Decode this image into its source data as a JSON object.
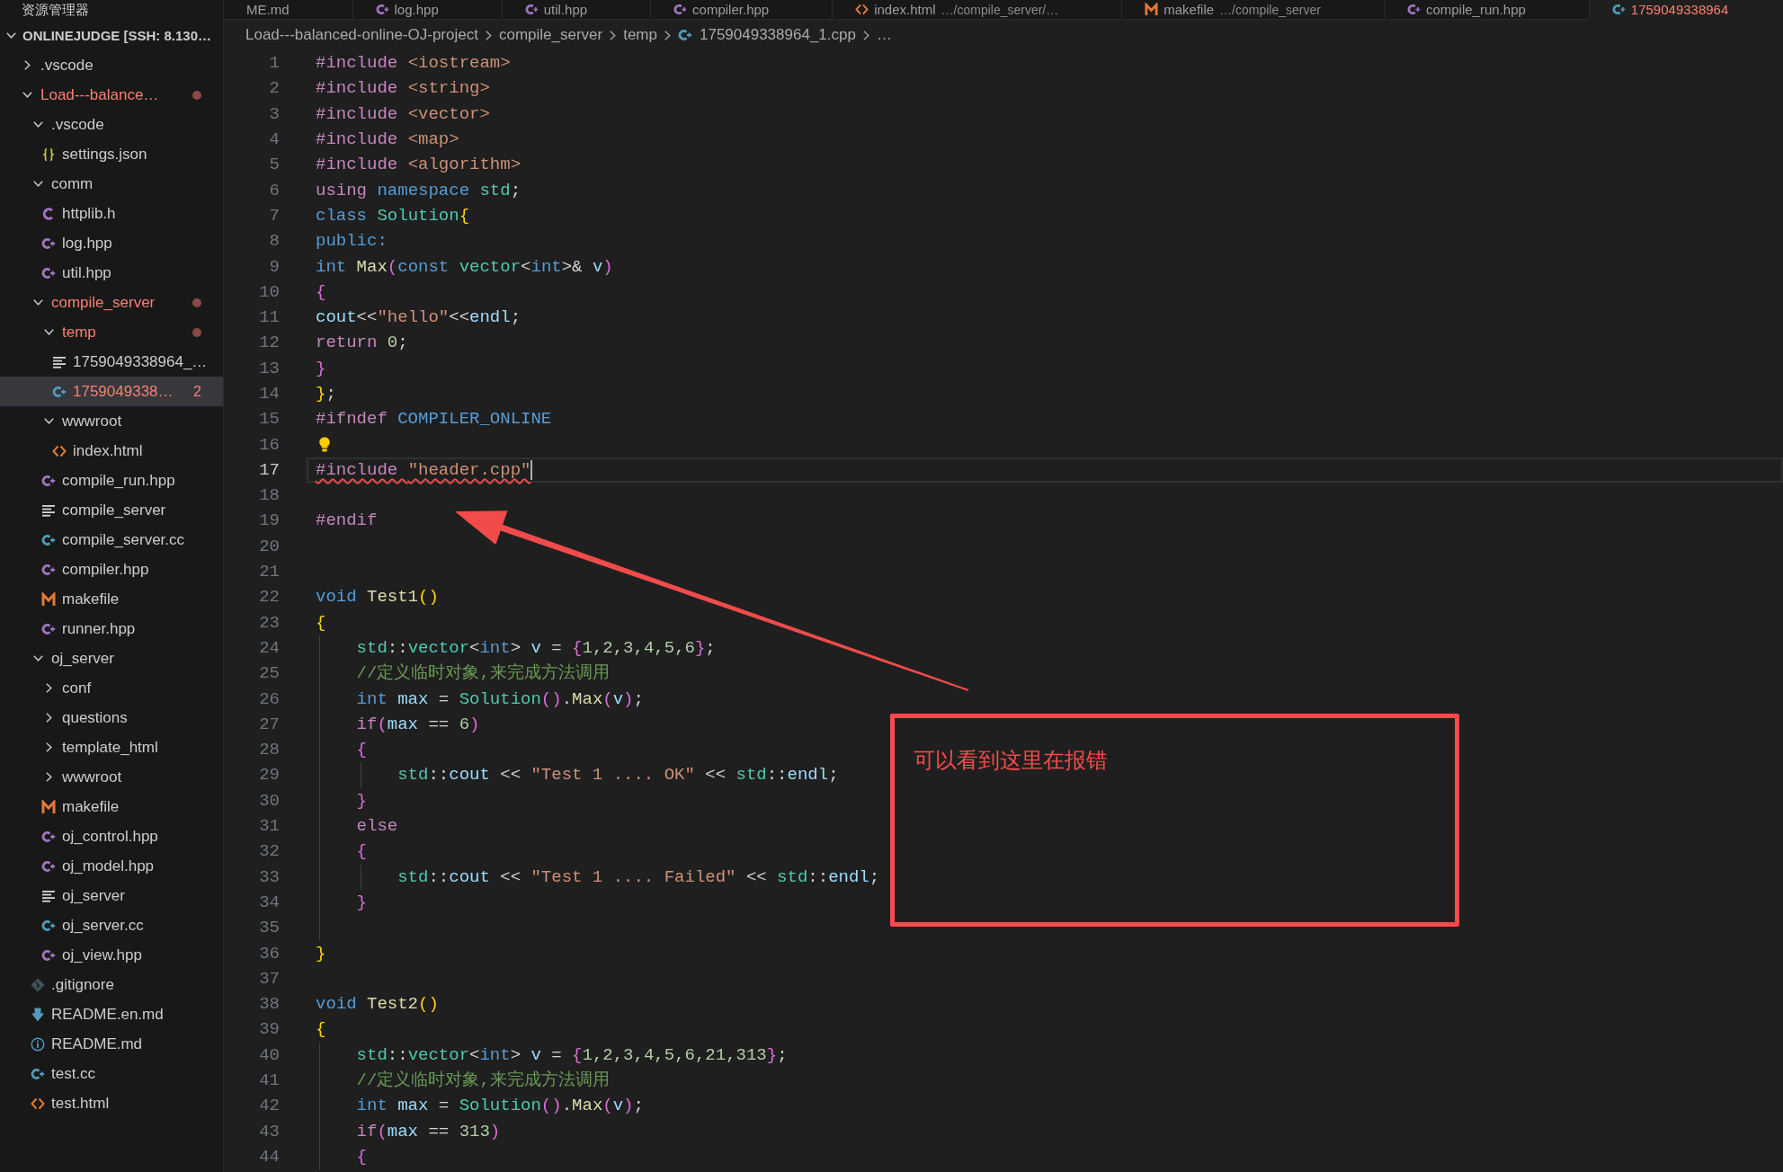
{
  "explorer": {
    "title": "资源管理器",
    "root": {
      "label": "ONLINEJUDGE [SSH: 8.130…",
      "expanded": true,
      "children": [
        {
          "label": ".vscode",
          "kind": "folder",
          "expanded": false,
          "error": false,
          "selected": false
        },
        {
          "label": "Load---balance…",
          "kind": "folder",
          "expanded": true,
          "error": true,
          "selected": false,
          "children": [
            {
              "label": ".vscode",
              "kind": "folder",
              "expanded": true,
              "error": false,
              "selected": false,
              "children": [
                {
                  "label": "settings.json",
                  "kind": "json",
                  "error": false,
                  "selected": false
                }
              ]
            },
            {
              "label": "comm",
              "kind": "folder",
              "expanded": true,
              "error": false,
              "selected": false,
              "children": [
                {
                  "label": "httplib.h",
                  "kind": "c-header",
                  "error": false,
                  "selected": false
                },
                {
                  "label": "log.hpp",
                  "kind": "cpp-header",
                  "error": false,
                  "selected": false
                },
                {
                  "label": "util.hpp",
                  "kind": "cpp-header",
                  "error": false,
                  "selected": false
                }
              ]
            },
            {
              "label": "compile_server",
              "kind": "folder",
              "expanded": true,
              "error": true,
              "selected": false,
              "children": [
                {
                  "label": "temp",
                  "kind": "folder",
                  "expanded": true,
                  "error": true,
                  "selected": false,
                  "children": [
                    {
                      "label": "1759049338964_…",
                      "kind": "plain",
                      "error": false,
                      "selected": false
                    },
                    {
                      "label": "1759049338…",
                      "kind": "cpp-source",
                      "error": true,
                      "selected": true,
                      "badge": "2"
                    }
                  ]
                },
                {
                  "label": "wwwroot",
                  "kind": "folder",
                  "expanded": true,
                  "error": false,
                  "selected": false,
                  "children": [
                    {
                      "label": "index.html",
                      "kind": "html",
                      "error": false,
                      "selected": false
                    }
                  ]
                },
                {
                  "label": "compile_run.hpp",
                  "kind": "cpp-header",
                  "error": false,
                  "selected": false
                },
                {
                  "label": "compile_server",
                  "kind": "plain",
                  "error": false,
                  "selected": false
                },
                {
                  "label": "compile_server.cc",
                  "kind": "cpp-source",
                  "error": false,
                  "selected": false
                },
                {
                  "label": "compiler.hpp",
                  "kind": "cpp-header",
                  "error": false,
                  "selected": false
                },
                {
                  "label": "makefile",
                  "kind": "makefile",
                  "error": false,
                  "selected": false
                },
                {
                  "label": "runner.hpp",
                  "kind": "cpp-header",
                  "error": false,
                  "selected": false
                }
              ]
            },
            {
              "label": "oj_server",
              "kind": "folder",
              "expanded": true,
              "error": false,
              "selected": false,
              "children": [
                {
                  "label": "conf",
                  "kind": "folder",
                  "expanded": false,
                  "error": false,
                  "selected": false
                },
                {
                  "label": "questions",
                  "kind": "folder",
                  "expanded": false,
                  "error": false,
                  "selected": false
                },
                {
                  "label": "template_html",
                  "kind": "folder",
                  "expanded": false,
                  "error": false,
                  "selected": false
                },
                {
                  "label": "wwwroot",
                  "kind": "folder",
                  "expanded": false,
                  "error": false,
                  "selected": false
                },
                {
                  "label": "makefile",
                  "kind": "makefile",
                  "error": false,
                  "selected": false
                },
                {
                  "label": "oj_control.hpp",
                  "kind": "cpp-header",
                  "error": false,
                  "selected": false
                },
                {
                  "label": "oj_model.hpp",
                  "kind": "cpp-header",
                  "error": false,
                  "selected": false
                },
                {
                  "label": "oj_server",
                  "kind": "plain",
                  "error": false,
                  "selected": false
                },
                {
                  "label": "oj_server.cc",
                  "kind": "cpp-source",
                  "error": false,
                  "selected": false
                },
                {
                  "label": "oj_view.hpp",
                  "kind": "cpp-header",
                  "error": false,
                  "selected": false
                }
              ]
            },
            {
              "label": ".gitignore",
              "kind": "git",
              "error": false,
              "selected": false
            },
            {
              "label": "README.en.md",
              "kind": "markdown",
              "error": false,
              "selected": false
            },
            {
              "label": "README.md",
              "kind": "readme",
              "error": false,
              "selected": false
            },
            {
              "label": "test.cc",
              "kind": "cpp-source",
              "error": false,
              "selected": false
            },
            {
              "label": "test.html",
              "kind": "html",
              "error": false,
              "selected": false
            }
          ]
        }
      ]
    }
  },
  "tabs": [
    {
      "label": "ME.md",
      "selected": false,
      "error": false
    },
    {
      "label": "log.hpp",
      "kind": "cpp-header",
      "selected": false,
      "error": false
    },
    {
      "label": "util.hpp",
      "kind": "cpp-header",
      "selected": false,
      "error": false
    },
    {
      "label": "compiler.hpp",
      "kind": "cpp-header",
      "selected": false,
      "error": false
    },
    {
      "label": "index.html",
      "description": "…/compile_server/…",
      "kind": "html",
      "selected": false,
      "error": false
    },
    {
      "label": "makefile",
      "description": "…/compile_server",
      "kind": "makefile",
      "selected": false,
      "error": false
    },
    {
      "label": "compile_run.hpp",
      "kind": "cpp-header",
      "selected": false,
      "error": false
    },
    {
      "label": "1759049338964",
      "kind": "cpp-source",
      "selected": true,
      "error": true
    }
  ],
  "breadcrumbs": [
    {
      "label": "Load---balanced-online-OJ-project",
      "kind": "folder"
    },
    {
      "label": "compile_server",
      "kind": "folder"
    },
    {
      "label": "temp",
      "kind": "folder"
    },
    {
      "label": "1759049338964_1.cpp",
      "kind": "cpp-source"
    },
    {
      "label": "…",
      "kind": "symbols"
    }
  ],
  "editor": {
    "lines": [
      {
        "number": "1",
        "current": false,
        "error": false,
        "lightbulb": false,
        "tokens": [
          {
            "kind": "preproc",
            "text": "#include "
          },
          {
            "kind": "string",
            "text": "<iostream>"
          }
        ]
      },
      {
        "number": "2",
        "current": false,
        "error": false,
        "lightbulb": false,
        "tokens": [
          {
            "kind": "preproc",
            "text": "#include "
          },
          {
            "kind": "string",
            "text": "<string>"
          }
        ]
      },
      {
        "number": "3",
        "current": false,
        "error": false,
        "lightbulb": false,
        "tokens": [
          {
            "kind": "preproc",
            "text": "#include "
          },
          {
            "kind": "string",
            "text": "<vector>"
          }
        ]
      },
      {
        "number": "4",
        "current": false,
        "error": false,
        "lightbulb": false,
        "tokens": [
          {
            "kind": "preproc",
            "text": "#include "
          },
          {
            "kind": "string",
            "text": "<map>"
          }
        ]
      },
      {
        "number": "5",
        "current": false,
        "error": false,
        "lightbulb": false,
        "tokens": [
          {
            "kind": "preproc",
            "text": "#include "
          },
          {
            "kind": "string",
            "text": "<algorithm>"
          }
        ]
      },
      {
        "number": "6",
        "current": false,
        "error": false,
        "lightbulb": false,
        "tokens": [
          {
            "kind": "control",
            "text": "using "
          },
          {
            "kind": "keyword",
            "text": "namespace "
          },
          {
            "kind": "type",
            "text": "std"
          },
          {
            "kind": "plain",
            "text": ";"
          }
        ]
      },
      {
        "number": "7",
        "current": false,
        "error": false,
        "lightbulb": false,
        "tokens": [
          {
            "kind": "keyword",
            "text": "class "
          },
          {
            "kind": "type",
            "text": "Solution"
          },
          {
            "kind": "bracket1",
            "text": "{"
          }
        ]
      },
      {
        "number": "8",
        "current": false,
        "error": false,
        "lightbulb": false,
        "tokens": [
          {
            "kind": "keyword",
            "text": "public:"
          }
        ]
      },
      {
        "number": "9",
        "current": false,
        "error": false,
        "lightbulb": false,
        "tokens": [
          {
            "kind": "keyword",
            "text": "int "
          },
          {
            "kind": "function",
            "text": "Max"
          },
          {
            "kind": "bracket2",
            "text": "("
          },
          {
            "kind": "keyword",
            "text": "const "
          },
          {
            "kind": "type",
            "text": "vector"
          },
          {
            "kind": "plain",
            "text": "<"
          },
          {
            "kind": "keyword",
            "text": "int"
          },
          {
            "kind": "plain",
            "text": ">& "
          },
          {
            "kind": "variable",
            "text": "v"
          },
          {
            "kind": "bracket2",
            "text": ")"
          }
        ]
      },
      {
        "number": "10",
        "current": false,
        "error": false,
        "lightbulb": false,
        "tokens": [
          {
            "kind": "bracket2",
            "text": "{"
          }
        ]
      },
      {
        "number": "11",
        "current": false,
        "error": false,
        "lightbulb": false,
        "tokens": [
          {
            "kind": "variable",
            "text": "cout"
          },
          {
            "kind": "plain",
            "text": "<<"
          },
          {
            "kind": "string",
            "text": "\"hello\""
          },
          {
            "kind": "plain",
            "text": "<<"
          },
          {
            "kind": "variable",
            "text": "endl"
          },
          {
            "kind": "plain",
            "text": ";"
          }
        ]
      },
      {
        "number": "12",
        "current": false,
        "error": false,
        "lightbulb": false,
        "tokens": [
          {
            "kind": "control",
            "text": "return "
          },
          {
            "kind": "number",
            "text": "0"
          },
          {
            "kind": "plain",
            "text": ";"
          }
        ]
      },
      {
        "number": "13",
        "current": false,
        "error": false,
        "lightbulb": false,
        "tokens": [
          {
            "kind": "bracket2",
            "text": "}"
          }
        ]
      },
      {
        "number": "14",
        "current": false,
        "error": false,
        "lightbulb": false,
        "tokens": [
          {
            "kind": "bracket1",
            "text": "}"
          },
          {
            "kind": "plain",
            "text": ";"
          }
        ]
      },
      {
        "number": "15",
        "current": false,
        "error": false,
        "lightbulb": false,
        "tokens": [
          {
            "kind": "preproc",
            "text": "#ifndef "
          },
          {
            "kind": "macro",
            "text": "COMPILER_ONLINE"
          }
        ]
      },
      {
        "number": "16",
        "current": false,
        "error": false,
        "lightbulb": true
      },
      {
        "number": "17",
        "current": true,
        "error": true,
        "lightbulb": false,
        "tokens": [
          {
            "kind": "preproc",
            "text": "#include "
          },
          {
            "kind": "string",
            "text": "\"header.cpp\""
          }
        ]
      },
      {
        "number": "18",
        "current": false,
        "error": false,
        "lightbulb": false
      },
      {
        "number": "19",
        "current": false,
        "error": false,
        "lightbulb": false,
        "tokens": [
          {
            "kind": "preproc",
            "text": "#endif"
          }
        ]
      },
      {
        "number": "20",
        "current": false,
        "error": false,
        "lightbulb": false
      },
      {
        "number": "21",
        "current": false,
        "error": false,
        "lightbulb": false
      },
      {
        "number": "22",
        "current": false,
        "error": false,
        "lightbulb": false,
        "tokens": [
          {
            "kind": "keyword",
            "text": "void "
          },
          {
            "kind": "function",
            "text": "Test1"
          },
          {
            "kind": "bracket1",
            "text": "()"
          }
        ]
      },
      {
        "number": "23",
        "current": false,
        "error": false,
        "lightbulb": false,
        "tokens": [
          {
            "kind": "bracket1",
            "text": "{"
          }
        ]
      },
      {
        "number": "24",
        "current": false,
        "error": false,
        "lightbulb": false,
        "tokens": [
          {
            "kind": "type",
            "text": "    std"
          },
          {
            "kind": "plain",
            "text": "::"
          },
          {
            "kind": "type",
            "text": "vector"
          },
          {
            "kind": "plain",
            "text": "<"
          },
          {
            "kind": "keyword",
            "text": "int"
          },
          {
            "kind": "plain",
            "text": "> "
          },
          {
            "kind": "variable",
            "text": "v"
          },
          {
            "kind": "plain",
            "text": " = "
          },
          {
            "kind": "bracket2",
            "text": "{"
          },
          {
            "kind": "number",
            "text": "1,2,3,4,5,6"
          },
          {
            "kind": "bracket2",
            "text": "}"
          },
          {
            "kind": "plain",
            "text": ";"
          }
        ]
      },
      {
        "number": "25",
        "current": false,
        "error": false,
        "lightbulb": false,
        "tokens": [
          {
            "kind": "comment",
            "text": "    //定义临时对象,来完成方法调用"
          }
        ]
      },
      {
        "number": "26",
        "current": false,
        "error": false,
        "lightbulb": false,
        "tokens": [
          {
            "kind": "keyword",
            "text": "    int "
          },
          {
            "kind": "variable",
            "text": "max"
          },
          {
            "kind": "plain",
            "text": " = "
          },
          {
            "kind": "type",
            "text": "Solution"
          },
          {
            "kind": "bracket2",
            "text": "()"
          },
          {
            "kind": "plain",
            "text": "."
          },
          {
            "kind": "function",
            "text": "Max"
          },
          {
            "kind": "bracket2",
            "text": "("
          },
          {
            "kind": "variable",
            "text": "v"
          },
          {
            "kind": "bracket2",
            "text": ")"
          },
          {
            "kind": "plain",
            "text": ";"
          }
        ]
      },
      {
        "number": "27",
        "current": false,
        "error": false,
        "lightbulb": false,
        "tokens": [
          {
            "kind": "control",
            "text": "    if"
          },
          {
            "kind": "bracket2",
            "text": "("
          },
          {
            "kind": "variable",
            "text": "max"
          },
          {
            "kind": "plain",
            "text": " == "
          },
          {
            "kind": "number",
            "text": "6"
          },
          {
            "kind": "bracket2",
            "text": ")"
          }
        ]
      },
      {
        "number": "28",
        "current": false,
        "error": false,
        "lightbulb": false,
        "tokens": [
          {
            "kind": "bracket2",
            "text": "    {"
          }
        ]
      },
      {
        "number": "29",
        "current": false,
        "error": false,
        "lightbulb": false,
        "tokens": [
          {
            "kind": "type",
            "text": "        std"
          },
          {
            "kind": "plain",
            "text": "::"
          },
          {
            "kind": "variable",
            "text": "cout"
          },
          {
            "kind": "plain",
            "text": " << "
          },
          {
            "kind": "string",
            "text": "\"Test 1 .... OK\""
          },
          {
            "kind": "plain",
            "text": " << "
          },
          {
            "kind": "type",
            "text": "std"
          },
          {
            "kind": "plain",
            "text": "::"
          },
          {
            "kind": "variable",
            "text": "endl"
          },
          {
            "kind": "plain",
            "text": ";"
          }
        ]
      },
      {
        "number": "30",
        "current": false,
        "error": false,
        "lightbulb": false,
        "tokens": [
          {
            "kind": "bracket2",
            "text": "    }"
          }
        ]
      },
      {
        "number": "31",
        "current": false,
        "error": false,
        "lightbulb": false,
        "tokens": [
          {
            "kind": "control",
            "text": "    else"
          }
        ]
      },
      {
        "number": "32",
        "current": false,
        "error": false,
        "lightbulb": false,
        "tokens": [
          {
            "kind": "bracket2",
            "text": "    {"
          }
        ]
      },
      {
        "number": "33",
        "current": false,
        "error": false,
        "lightbulb": false,
        "tokens": [
          {
            "kind": "type",
            "text": "        std"
          },
          {
            "kind": "plain",
            "text": "::"
          },
          {
            "kind": "variable",
            "text": "cout"
          },
          {
            "kind": "plain",
            "text": " << "
          },
          {
            "kind": "string",
            "text": "\"Test 1 .... Failed\""
          },
          {
            "kind": "plain",
            "text": " << "
          },
          {
            "kind": "type",
            "text": "std"
          },
          {
            "kind": "plain",
            "text": "::"
          },
          {
            "kind": "variable",
            "text": "endl"
          },
          {
            "kind": "plain",
            "text": ";"
          }
        ]
      },
      {
        "number": "34",
        "current": false,
        "error": false,
        "lightbulb": false,
        "tokens": [
          {
            "kind": "bracket2",
            "text": "    }"
          }
        ]
      },
      {
        "number": "35",
        "current": false,
        "error": false,
        "lightbulb": false
      },
      {
        "number": "36",
        "current": false,
        "error": false,
        "lightbulb": false,
        "tokens": [
          {
            "kind": "bracket1",
            "text": "}"
          }
        ]
      },
      {
        "number": "37",
        "current": false,
        "error": false,
        "lightbulb": false
      },
      {
        "number": "38",
        "current": false,
        "error": false,
        "lightbulb": false,
        "tokens": [
          {
            "kind": "keyword",
            "text": "void "
          },
          {
            "kind": "function",
            "text": "Test2"
          },
          {
            "kind": "bracket1",
            "text": "()"
          }
        ]
      },
      {
        "number": "39",
        "current": false,
        "error": false,
        "lightbulb": false,
        "tokens": [
          {
            "kind": "bracket1",
            "text": "{"
          }
        ]
      },
      {
        "number": "40",
        "current": false,
        "error": false,
        "lightbulb": false,
        "tokens": [
          {
            "kind": "type",
            "text": "    std"
          },
          {
            "kind": "plain",
            "text": "::"
          },
          {
            "kind": "type",
            "text": "vector"
          },
          {
            "kind": "plain",
            "text": "<"
          },
          {
            "kind": "keyword",
            "text": "int"
          },
          {
            "kind": "plain",
            "text": "> "
          },
          {
            "kind": "variable",
            "text": "v"
          },
          {
            "kind": "plain",
            "text": " = "
          },
          {
            "kind": "bracket2",
            "text": "{"
          },
          {
            "kind": "number",
            "text": "1,2,3,4,5,6,21,313"
          },
          {
            "kind": "bracket2",
            "text": "}"
          },
          {
            "kind": "plain",
            "text": ";"
          }
        ]
      },
      {
        "number": "41",
        "current": false,
        "error": false,
        "lightbulb": false,
        "tokens": [
          {
            "kind": "comment",
            "text": "    //定义临时对象,来完成方法调用"
          }
        ]
      },
      {
        "number": "42",
        "current": false,
        "error": false,
        "lightbulb": false,
        "tokens": [
          {
            "kind": "keyword",
            "text": "    int "
          },
          {
            "kind": "variable",
            "text": "max"
          },
          {
            "kind": "plain",
            "text": " = "
          },
          {
            "kind": "type",
            "text": "Solution"
          },
          {
            "kind": "bracket2",
            "text": "()"
          },
          {
            "kind": "plain",
            "text": "."
          },
          {
            "kind": "function",
            "text": "Max"
          },
          {
            "kind": "bracket2",
            "text": "("
          },
          {
            "kind": "variable",
            "text": "v"
          },
          {
            "kind": "bracket2",
            "text": ")"
          },
          {
            "kind": "plain",
            "text": ";"
          }
        ]
      },
      {
        "number": "43",
        "current": false,
        "error": false,
        "lightbulb": false,
        "tokens": [
          {
            "kind": "control",
            "text": "    if"
          },
          {
            "kind": "bracket2",
            "text": "("
          },
          {
            "kind": "variable",
            "text": "max"
          },
          {
            "kind": "plain",
            "text": " == "
          },
          {
            "kind": "number",
            "text": "313"
          },
          {
            "kind": "bracket2",
            "text": ")"
          }
        ]
      },
      {
        "number": "44",
        "current": false,
        "error": false,
        "lightbulb": false,
        "tokens": [
          {
            "kind": "bracket2",
            "text": "    {"
          }
        ]
      }
    ]
  },
  "annotation": {
    "text": "可以看到这里在报错"
  }
}
